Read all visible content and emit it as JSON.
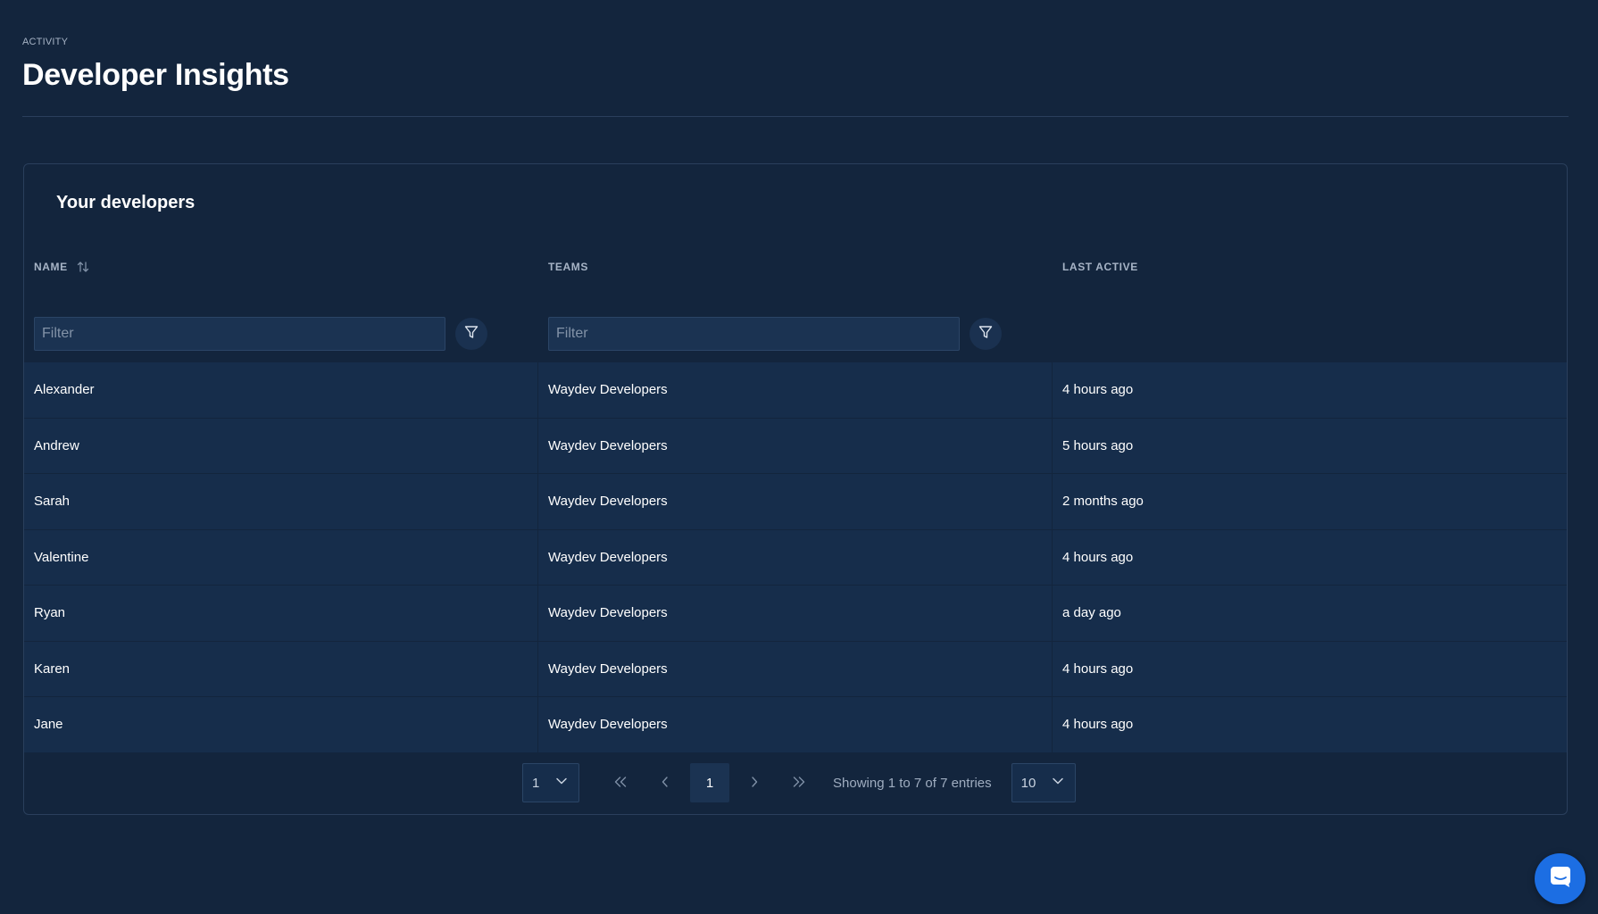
{
  "header": {
    "eyebrow": "ACTIVITY",
    "title": "Developer Insights"
  },
  "card": {
    "title": "Your developers"
  },
  "table": {
    "columns": [
      "NAME",
      "TEAMS",
      "LAST ACTIVE"
    ],
    "filter_placeholder": "Filter",
    "rows": [
      {
        "name": "Alexander",
        "team": "Waydev Developers",
        "last_active": "4 hours ago"
      },
      {
        "name": "Andrew",
        "team": "Waydev Developers",
        "last_active": "5 hours ago"
      },
      {
        "name": "Sarah",
        "team": "Waydev Developers",
        "last_active": "2 months ago"
      },
      {
        "name": "Valentine",
        "team": "Waydev Developers",
        "last_active": "4 hours ago"
      },
      {
        "name": "Ryan",
        "team": "Waydev Developers",
        "last_active": "a day ago"
      },
      {
        "name": "Karen",
        "team": "Waydev Developers",
        "last_active": "4 hours ago"
      },
      {
        "name": "Jane",
        "team": "Waydev Developers",
        "last_active": "4 hours ago"
      }
    ]
  },
  "pagination": {
    "page_select_value": "1",
    "current_page": "1",
    "summary": "Showing 1 to 7 of 7 entries",
    "page_size": "10"
  },
  "icons": {
    "sort": "sort-arrows-icon",
    "filter": "filter-funnel-icon",
    "first": "double-chevron-left-icon",
    "prev": "chevron-left-icon",
    "next": "chevron-right-icon",
    "last": "double-chevron-right-icon",
    "dropdown": "chevron-down-icon",
    "chat": "chat-icon"
  },
  "colors": {
    "background": "#13253d",
    "row": "#162d4b",
    "accent": "#1c6ee3"
  }
}
